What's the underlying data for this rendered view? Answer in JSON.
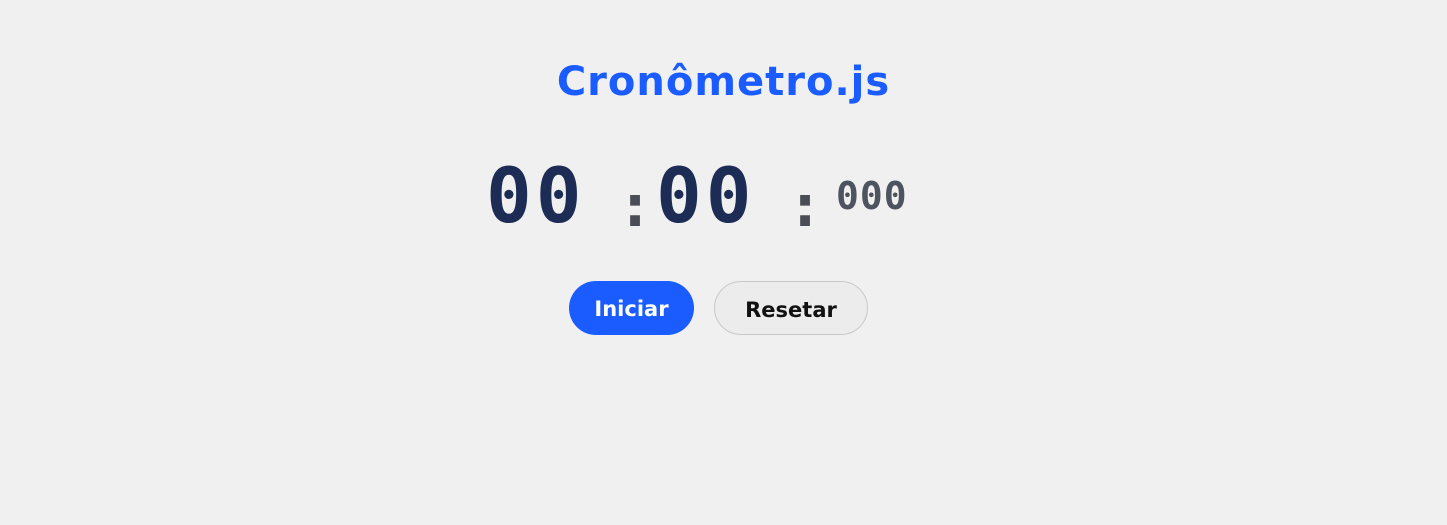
{
  "app": {
    "title": "Cronômetro.js"
  },
  "timer": {
    "minutes": "00",
    "separator_1": ":",
    "seconds": "00",
    "separator_2": ":",
    "milliseconds": "000"
  },
  "controls": {
    "start_label": "Iniciar",
    "reset_label": "Resetar"
  },
  "colors": {
    "accent": "#1a5cff",
    "digits": "#1c2c55",
    "background": "#f0f0f0"
  }
}
